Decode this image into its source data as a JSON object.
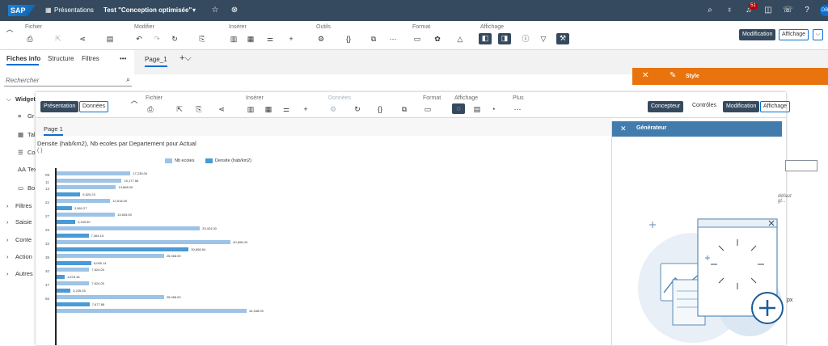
{
  "shell": {
    "logo": "SAP",
    "app": "Présentations",
    "doc": "Test \"Conception optimisée\"",
    "doc_suffix": "▾",
    "notif_count": "51",
    "avatar": "DB"
  },
  "toolbar": {
    "groups": {
      "file": "Fichier",
      "modify": "Modifier",
      "insert": "Insérer",
      "tools": "Outils",
      "format": "Format",
      "display": "Affichage"
    },
    "mode_on": "Modification",
    "mode_off": "Affichage"
  },
  "left": {
    "tabs": [
      "Fiches info",
      "Structure",
      "Filtres"
    ],
    "more": "•••",
    "search_placeholder": "Rechercher",
    "items": [
      {
        "label": "Widget",
        "type": "group"
      },
      {
        "label": "Gr",
        "icon": "≡"
      },
      {
        "label": "Tal",
        "icon": "▦"
      },
      {
        "label": "Co",
        "icon": "☰"
      },
      {
        "label": "Tex",
        "icon": "AA"
      },
      {
        "label": "Bo",
        "icon": "▭"
      },
      {
        "label": "Filtres",
        "type": "group"
      },
      {
        "label": "Saisie",
        "type": "group"
      },
      {
        "label": "Conte",
        "type": "group"
      },
      {
        "label": "Action",
        "type": "group"
      },
      {
        "label": "Autres",
        "type": "group"
      }
    ]
  },
  "page_tab": "Page_1",
  "style_panel": {
    "title": "Style"
  },
  "inner": {
    "seg": [
      "Présentation",
      "Données"
    ],
    "groups": {
      "file": "Fichier",
      "insert": "Insérer",
      "data": "Données",
      "format": "Format",
      "display": "Affichage",
      "more": "Plus"
    },
    "right_links": [
      "Concepteur",
      "Contrôles"
    ],
    "mode_on": "Modification",
    "mode_off": "Affichage",
    "page_tab": "Page 1",
    "gen_title": "Générateur",
    "gen_field2": "défaut gl...",
    "gen_unit": "px"
  },
  "chart_data": {
    "type": "bar",
    "title": "Densite (hab/km2), Nb ecoles par Departement pour Actual",
    "subtitle": "( )",
    "orientation": "horizontal",
    "categories": [
      "09",
      "11",
      "13",
      "22",
      "27",
      "25",
      "33",
      "38",
      "40",
      "47",
      "56"
    ],
    "series": [
      {
        "name": "Nb ecoles",
        "color": "#9dc3e6",
        "values": [
          17235,
          15177.56,
          13868,
          12518,
          13605,
          33424,
          40606,
          25068,
          7624,
          7624,
          25068
        ]
      },
      {
        "name": "Densite (hab/km2)",
        "color": "#4a9ad6",
        "values": [
          null,
          null,
          5520.23,
          3560.27,
          4349.5,
          7464.15,
          30808.84,
          8095.14,
          1878.18,
          3235.26,
          7677.88
        ]
      }
    ],
    "extra_bar": {
      "value": 44348,
      "label": "44,348.00"
    },
    "labels": [
      [
        "17,235.00",
        ""
      ],
      [
        "15,177.56",
        ""
      ],
      [
        "13,868.00",
        "5,520.23"
      ],
      [
        "12,518.00",
        "3,560.27"
      ],
      [
        "13,605.00",
        "4,349.50"
      ],
      [
        "33,424.00",
        "7,464.15"
      ],
      [
        "40,606.00",
        "30,808.84"
      ],
      [
        "25,068.00",
        "8,095.14"
      ],
      [
        "7,624.00",
        "1,878.18"
      ],
      [
        "7,624.00",
        "3,235.26"
      ],
      [
        "25,068.00",
        "7,677.88"
      ]
    ],
    "extra_labels": {
      "a": "7,624.00",
      "b": "7,624.00"
    },
    "legend": "top-center"
  }
}
